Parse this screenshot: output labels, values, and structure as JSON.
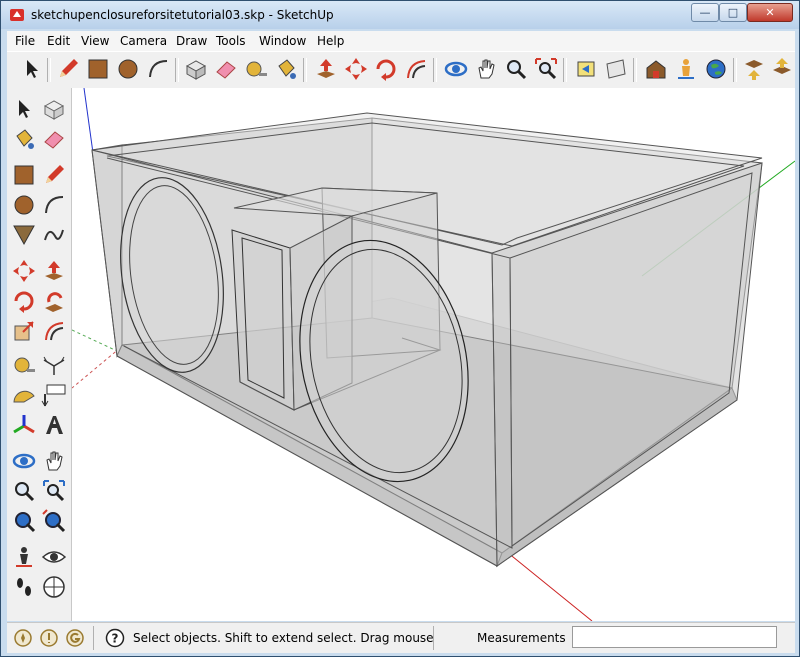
{
  "window": {
    "title": "sketchupenclosureforsitetutorial03.skp - SketchUp"
  },
  "menubar": {
    "items": [
      "File",
      "Edit",
      "View",
      "Camera",
      "Draw",
      "Tools",
      "Window",
      "Help"
    ]
  },
  "statusbar": {
    "hint": "Select objects. Shift to extend select. Drag mouse",
    "measurements_label": "Measurements",
    "measurements_value": ""
  },
  "colors": {
    "title_bg": "#c9dcee",
    "axis_red": "#cc2222",
    "axis_green": "#22aa22",
    "axis_blue": "#2233cc",
    "model_fill": "#c8c8c8"
  }
}
